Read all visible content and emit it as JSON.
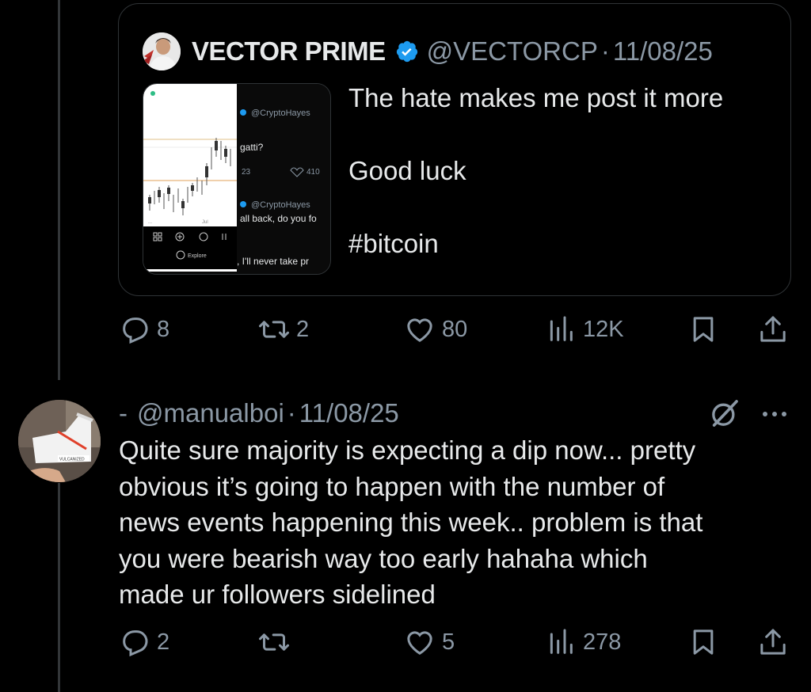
{
  "quoted_post": {
    "author_name": "VECTOR PRIME",
    "handle": "@VECTORCP",
    "separator": "·",
    "date": "11/08/25",
    "text_lines": [
      "The hate makes me post it more",
      "",
      "Good luck",
      "",
      "#bitcoin"
    ],
    "thumbnail": {
      "handle_1": "@CryptoHayes",
      "snippet_1": "gatti?",
      "stat_reply": "23",
      "stat_like": "410",
      "handle_2": "@CryptoHayes",
      "snippet_2": "all back, do you fo",
      "snippet_3": ", I'll never take pr",
      "explore_label": "Explore",
      "axis_label": "Jul"
    }
  },
  "quoted_post_actions": {
    "replies": "8",
    "reposts": "2",
    "likes": "80",
    "views": "12K"
  },
  "reply_post": {
    "author_name": "-",
    "handle": "@manualboi",
    "separator": "·",
    "date": "11/08/25",
    "avatar_shoe_label": "VULCANIZED",
    "text_lines": [
      "Quite sure majority is expecting a dip now... pretty",
      "obvious it’s going to happen with the number of",
      "news events happening this week.. problem is that",
      "you were bearish way too early hahaha which",
      "made ur followers sidelined"
    ]
  },
  "reply_post_actions": {
    "replies": "2",
    "reposts": "",
    "likes": "5",
    "views": "278"
  },
  "colors": {
    "background": "#000000",
    "text_primary": "#e7e9ea",
    "text_secondary": "#8b98a5",
    "border": "#2f3336",
    "verified_blue": "#1d9bf0"
  },
  "icons": {
    "reply": "reply-icon",
    "repost": "repost-icon",
    "like": "like-icon",
    "views": "views-icon",
    "bookmark": "bookmark-icon",
    "share": "share-icon",
    "grok": "grok-icon",
    "more": "more-icon",
    "verified": "verified-badge-icon"
  }
}
